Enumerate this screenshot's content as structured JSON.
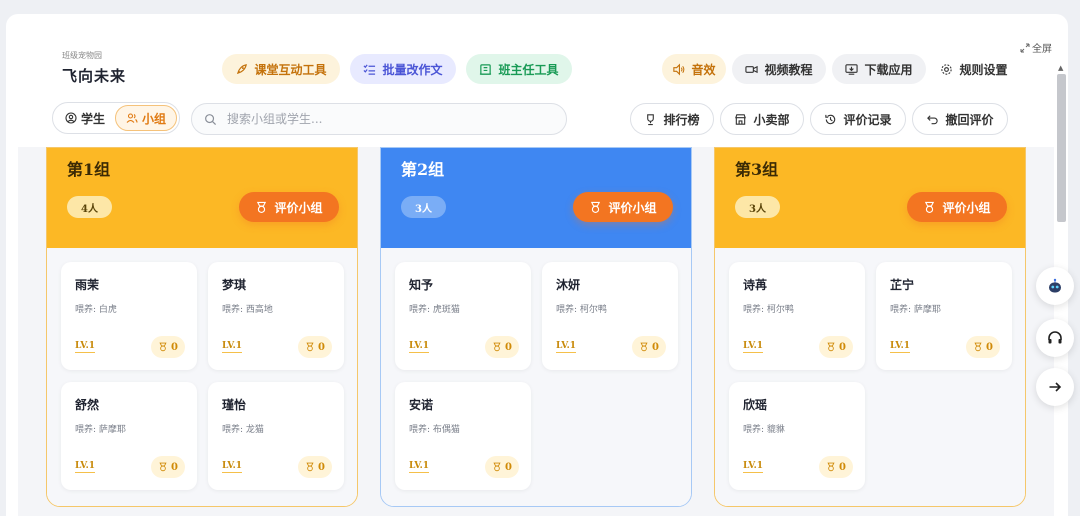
{
  "brand": {
    "subtitle": "班级宠物园",
    "title": "飞向未来"
  },
  "fullscreen_label": "全屏",
  "tools": {
    "classroom": "课堂互动工具",
    "batch": "批量改作文",
    "teacher": "班主任工具",
    "sound": "音效",
    "video": "视频教程",
    "download": "下载应用",
    "rules": "规则设置"
  },
  "view_toggle": {
    "student": "学生",
    "group": "小组",
    "selected": "小组"
  },
  "search": {
    "placeholder": "搜索小组或学生..."
  },
  "actions": {
    "rank": "排行榜",
    "shop": "小卖部",
    "record": "评价记录",
    "undo": "撤回评价"
  },
  "colors": {
    "accent_orange": "#f37521",
    "group_yellow": "#fcb825",
    "group_blue": "#3f87f2"
  },
  "groups": [
    {
      "name": "第1组",
      "count": "4人",
      "evaluate_label": "评价小组",
      "members": [
        {
          "name": "雨茉",
          "pet": "喂养: 白虎",
          "level": "LV.1",
          "score": "0"
        },
        {
          "name": "梦琪",
          "pet": "喂养: 西高地",
          "level": "LV.1",
          "score": "0"
        },
        {
          "name": "舒然",
          "pet": "喂养: 萨摩耶",
          "level": "LV.1",
          "score": "0"
        },
        {
          "name": "瑾怡",
          "pet": "喂养: 龙猫",
          "level": "LV.1",
          "score": "0"
        }
      ]
    },
    {
      "name": "第2组",
      "count": "3人",
      "evaluate_label": "评价小组",
      "members": [
        {
          "name": "知予",
          "pet": "喂养: 虎斑猫",
          "level": "LV.1",
          "score": "0"
        },
        {
          "name": "沐妍",
          "pet": "喂养: 柯尔鸭",
          "level": "LV.1",
          "score": "0"
        },
        {
          "name": "安诺",
          "pet": "喂养: 布偶猫",
          "level": "LV.1",
          "score": "0"
        }
      ]
    },
    {
      "name": "第3组",
      "count": "3人",
      "evaluate_label": "评价小组",
      "members": [
        {
          "name": "诗苒",
          "pet": "喂养: 柯尔鸭",
          "level": "LV.1",
          "score": "0"
        },
        {
          "name": "芷宁",
          "pet": "喂养: 萨摩耶",
          "level": "LV.1",
          "score": "0"
        },
        {
          "name": "欣瑶",
          "pet": "喂养: 貔貅",
          "level": "LV.1",
          "score": "0"
        }
      ]
    }
  ],
  "floating": {
    "bot": "robot-icon",
    "support": "headset-icon",
    "next": "arrow-right-icon"
  }
}
